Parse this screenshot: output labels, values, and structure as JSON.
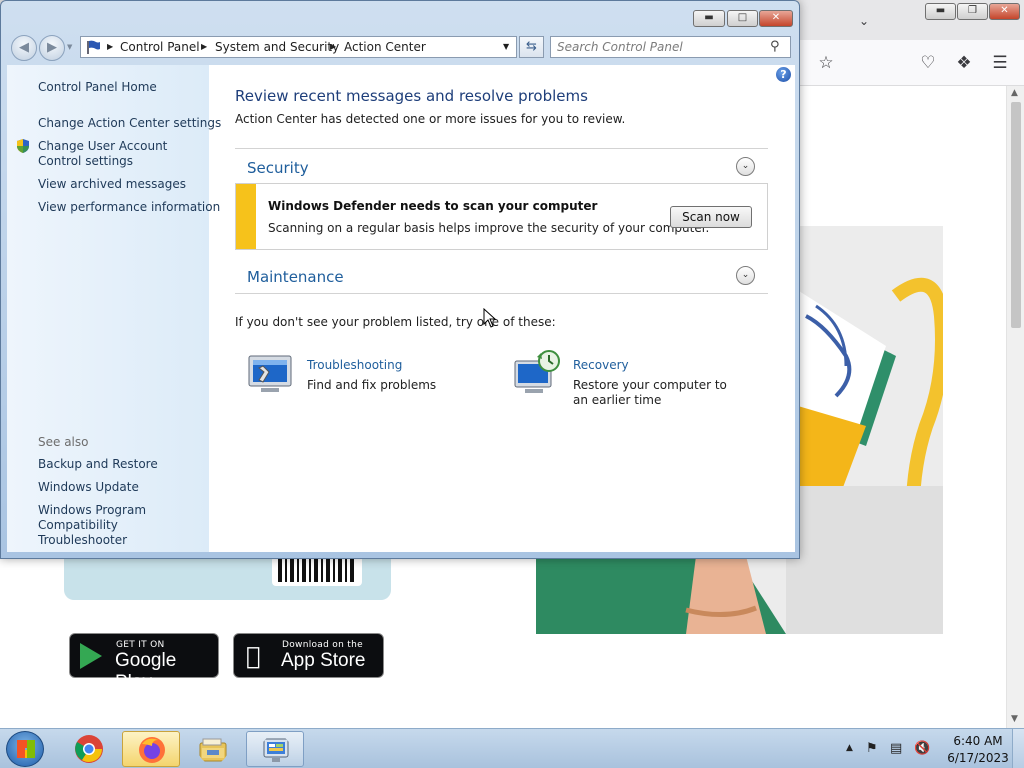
{
  "window": {
    "title": "",
    "breadcrumb": [
      "Control Panel",
      "System and Security",
      "Action Center"
    ],
    "search_placeholder": "Search Control Panel"
  },
  "sidebar": {
    "home": "Control Panel Home",
    "links": [
      "Change Action Center settings",
      "Change User Account Control settings",
      "View archived messages",
      "View performance information"
    ],
    "see_also_label": "See also",
    "see_also": [
      "Backup and Restore",
      "Windows Update",
      "Windows Program Compatibility Troubleshooter"
    ]
  },
  "main": {
    "heading": "Review recent messages and resolve problems",
    "subheading": "Action Center has detected one or more issues for you to review.",
    "security": {
      "title": "Security",
      "alert_title": "Windows Defender needs to scan your computer",
      "alert_desc": "Scanning on a regular basis helps improve the security of your computer.",
      "alert_button": "Scan now",
      "alert_color": "#f6c21b"
    },
    "maintenance": {
      "title": "Maintenance"
    },
    "hint": "If you don't see your problem listed, try one of these:",
    "tools": [
      {
        "title": "Troubleshooting",
        "desc": "Find and fix problems",
        "icon": "troubleshooting-icon"
      },
      {
        "title": "Recovery",
        "desc": "Restore your computer to an earlier time",
        "icon": "recovery-icon"
      }
    ]
  },
  "browser_page": {
    "google_play_small": "GET IT ON",
    "google_play_big": "Google Play",
    "app_store_small": "Download on the",
    "app_store_big": "App Store"
  },
  "taskbar": {
    "apps": [
      "chrome-icon",
      "firefox-icon",
      "file-explorer-icon",
      "control-panel-icon"
    ],
    "time": "6:40 AM",
    "date": "6/17/2023"
  },
  "colors": {
    "link": "#1f5e9c",
    "heading": "#1e3e7a",
    "taskbar": "#b5cbe2"
  }
}
